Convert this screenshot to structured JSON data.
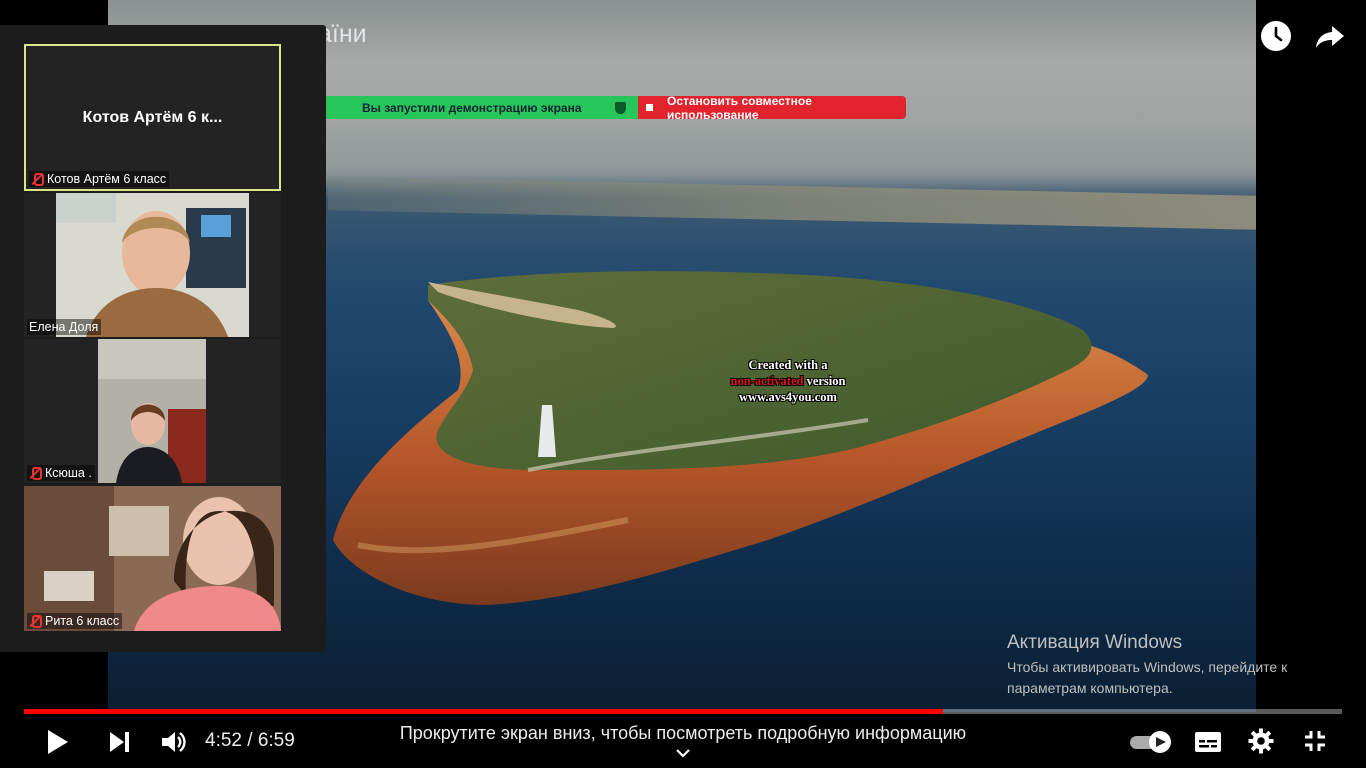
{
  "slide": {
    "title": "аїни",
    "watermark": {
      "line1": "Created with a",
      "line2_red": "non-activated",
      "line2_rest": "version",
      "line3": "www.avs4you.com"
    }
  },
  "share_banner": {
    "status_text": "Вы запустили демонстрацию экрана",
    "stop_label": "Остановить совместное использование"
  },
  "participants": [
    {
      "name": "Котов Артём 6 класс",
      "display_name": "Котов Артём 6 к...",
      "muted": true,
      "active": true
    },
    {
      "name": "Елена Доля",
      "muted": false
    },
    {
      "name": "Ксюша .",
      "muted": true
    },
    {
      "name": "Рита 6 класс",
      "muted": true
    }
  ],
  "windows_activation": {
    "title": "Активация Windows",
    "line1": "Чтобы активировать Windows, перейдите к",
    "line2": "параметрам компьютера."
  },
  "player": {
    "time_current": "4:52",
    "time_total": "6:59",
    "time_display": "4:52 / 6:59",
    "scroll_hint": "Прокрутите экран вниз, чтобы посмотреть подробную информацию",
    "progress_fraction": 0.697,
    "autoplay_on": true,
    "accent_color": "#ff0000"
  },
  "icons": [
    "watch-later-icon",
    "share-icon",
    "play-icon",
    "next-icon",
    "volume-icon",
    "autoplay-toggle",
    "subtitles-icon",
    "settings-icon",
    "exit-fullscreen-icon",
    "chevron-down-icon",
    "mic-off-icon",
    "shield-icon"
  ]
}
